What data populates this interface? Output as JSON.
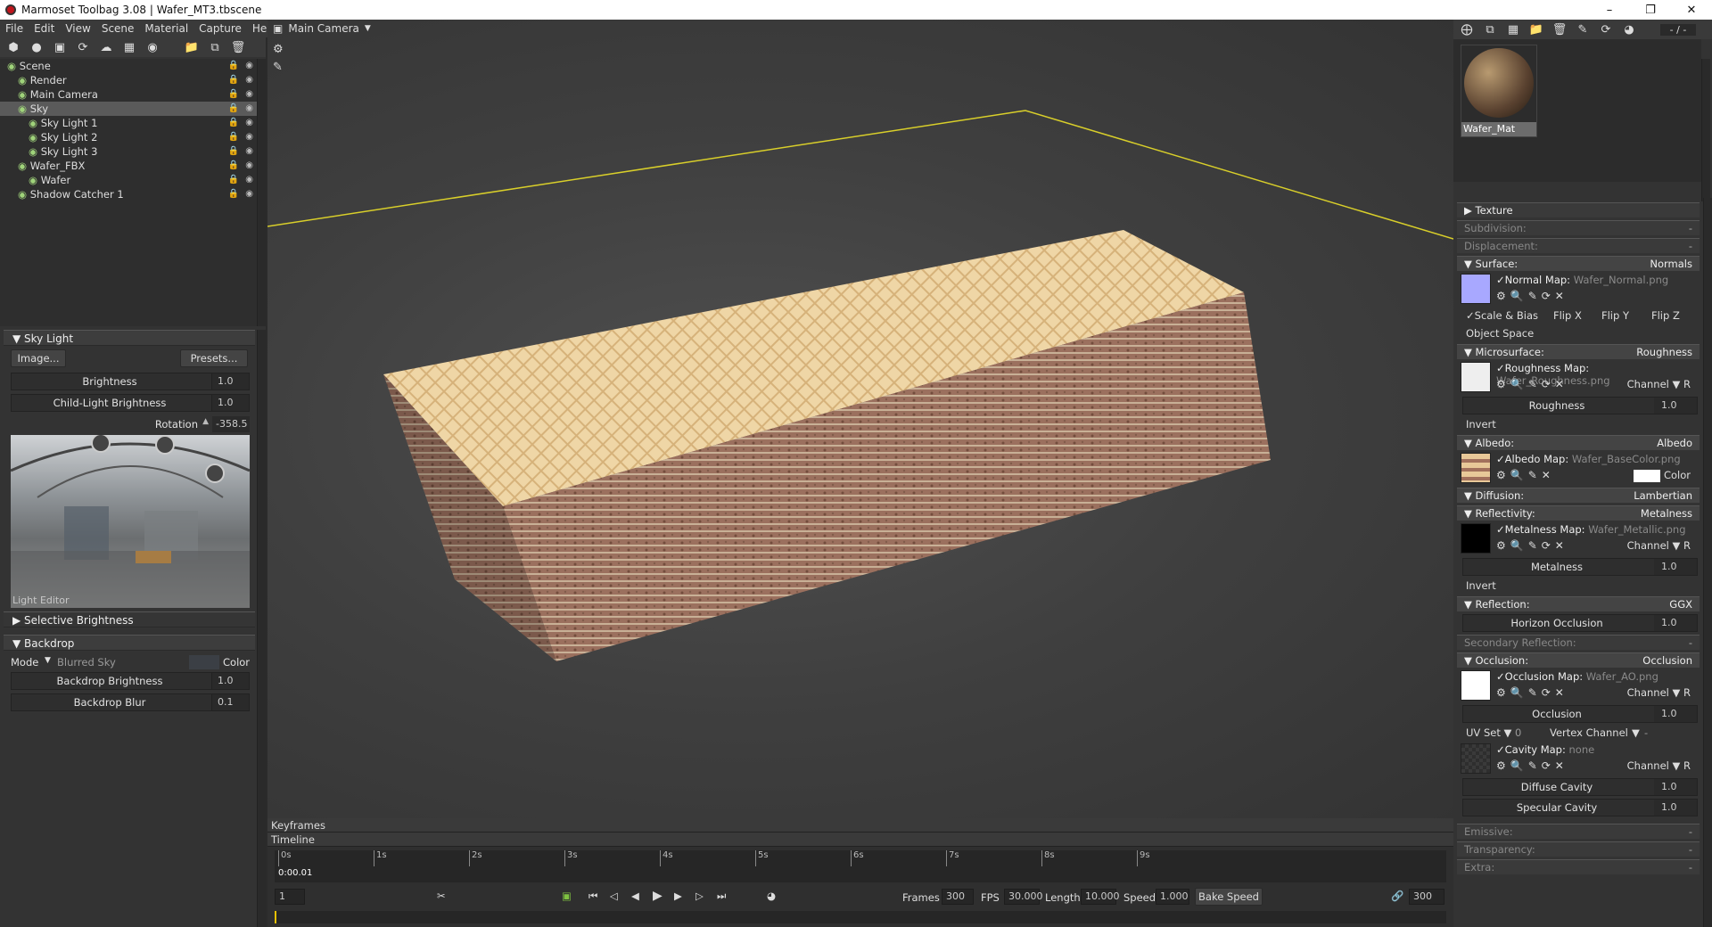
{
  "window": {
    "title": "Marmoset Toolbag 3.08  |  Wafer_MT3.tbscene"
  },
  "menu": [
    "File",
    "Edit",
    "View",
    "Scene",
    "Material",
    "Capture",
    "Help"
  ],
  "scene_tree": [
    {
      "label": "Scene",
      "indent": 0
    },
    {
      "label": "Render",
      "indent": 1
    },
    {
      "label": "Main Camera",
      "indent": 1
    },
    {
      "label": "Sky",
      "indent": 1,
      "selected": true
    },
    {
      "label": "Sky Light 1",
      "indent": 2
    },
    {
      "label": "Sky Light 2",
      "indent": 2
    },
    {
      "label": "Sky Light 3",
      "indent": 2
    },
    {
      "label": "Wafer_FBX",
      "indent": 1
    },
    {
      "label": "Wafer",
      "indent": 2
    },
    {
      "label": "Shadow Catcher 1",
      "indent": 1
    }
  ],
  "sky_panel": {
    "title": "Sky Light",
    "image_btn": "Image...",
    "presets_btn": "Presets...",
    "brightness_label": "Brightness",
    "brightness": "1.0",
    "child_label": "Child-Light Brightness",
    "child": "1.0",
    "rotation_label": "Rotation",
    "rotation": "-358.5",
    "light_editor": "Light Editor",
    "selective": "Selective Brightness"
  },
  "backdrop": {
    "title": "Backdrop",
    "mode_label": "Mode",
    "mode": "Blurred Sky",
    "color_label": "Color",
    "brightness_label": "Backdrop Brightness",
    "brightness": "1.0",
    "blur_label": "Backdrop Blur",
    "blur": "0.1"
  },
  "viewport": {
    "camera": "Main Camera"
  },
  "timeline": {
    "keyframes": "Keyframes",
    "timeline": "Timeline",
    "time": "0:00.01",
    "ticks": [
      "0s",
      "1s",
      "2s",
      "3s",
      "4s",
      "5s",
      "6s",
      "7s",
      "8s",
      "9s"
    ],
    "frame": "1",
    "frames_label": "Frames",
    "frames": "300",
    "fps_label": "FPS",
    "fps": "30.000",
    "length_label": "Length",
    "length": "10.000",
    "speed_label": "Speed",
    "speed": "1.000",
    "bake_label": "Bake Speed",
    "end_frame": "300"
  },
  "material": {
    "name": "Wafer_Mat",
    "counter": "- / -",
    "texture": "Texture",
    "subdivision": {
      "label": "Subdivision:",
      "value": "-"
    },
    "displacement": {
      "label": "Displacement:",
      "value": "-"
    },
    "surface": {
      "label": "Surface:",
      "value": "Normals",
      "map": "Normal Map:",
      "file": "Wafer_Normal.png",
      "scale_bias": "Scale & Bias",
      "flipx": "Flip X",
      "flipy": "Flip Y",
      "flipz": "Flip Z",
      "object_space": "Object Space"
    },
    "micro": {
      "label": "Microsurface:",
      "value": "Roughness",
      "map": "Roughness Map:",
      "file": "Wafer_Roughness.png",
      "channel": "Channel",
      "ch": "R",
      "slider": "Roughness",
      "val": "1.0",
      "invert": "Invert"
    },
    "albedo": {
      "label": "Albedo:",
      "value": "Albedo",
      "map": "Albedo Map:",
      "file": "Wafer_BaseColor.png",
      "color": "Color"
    },
    "diffusion": {
      "label": "Diffusion:",
      "value": "Lambertian"
    },
    "reflectivity": {
      "label": "Reflectivity:",
      "value": "Metalness",
      "map": "Metalness Map:",
      "file": "Wafer_Metallic.png",
      "channel": "Channel",
      "ch": "R",
      "slider": "Metalness",
      "val": "1.0",
      "invert": "Invert"
    },
    "reflection": {
      "label": "Reflection:",
      "value": "GGX",
      "slider": "Horizon Occlusion",
      "val": "1.0"
    },
    "secondary": {
      "label": "Secondary Reflection:",
      "value": "-"
    },
    "occlusion": {
      "label": "Occlusion:",
      "value": "Occlusion",
      "map": "Occlusion Map:",
      "file": "Wafer_AO.png",
      "channel": "Channel",
      "ch": "R",
      "slider": "Occlusion",
      "val": "1.0",
      "uvset": "UV Set",
      "uv": "0",
      "vertex": "Vertex Channel",
      "vertex_val": "-",
      "cavity": "Cavity Map:",
      "cavity_file": "none",
      "diffuse_cavity": "Diffuse Cavity",
      "dc": "1.0",
      "specular_cavity": "Specular Cavity",
      "sc": "1.0"
    },
    "emissive": {
      "label": "Emissive:",
      "value": "-"
    },
    "transparency": {
      "label": "Transparency:",
      "value": "-"
    },
    "extra": {
      "label": "Extra:",
      "value": "-"
    }
  }
}
